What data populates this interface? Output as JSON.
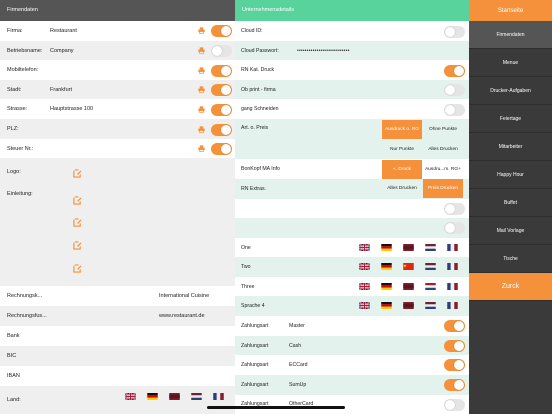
{
  "left": {
    "header": "Firmendaten",
    "fields": [
      {
        "label": "Firma:",
        "value": "Restaurant",
        "toggle": true
      },
      {
        "label": "Betriebsname:",
        "value": "Company",
        "toggle": false
      },
      {
        "label": "Mobiltelefon:",
        "value": "",
        "toggle": true
      },
      {
        "label": "Stadt:",
        "value": "Frankfurt",
        "toggle": true
      },
      {
        "label": "Strasse:",
        "value": "Hauptstrasse 100",
        "toggle": true
      },
      {
        "label": "PLZ:",
        "value": "",
        "toggle": true
      },
      {
        "label": "Steuer Nr.:",
        "value": "",
        "toggle": true
      }
    ],
    "logo_label": "Logo:",
    "einleitung_label": "Einleitung:",
    "rechnungsk_label": "Rechnungsk...",
    "rechnungsk_value": "International Cuisine",
    "rechnungsfus_label": "Rechnungsfus...",
    "rechnungsfus_value": "www.restaurant.de",
    "bank_label": "Bank",
    "bic_label": "BIC",
    "iban_label": "IBAN",
    "land_label": "Land:"
  },
  "mid": {
    "header": "Unternehmensdetails",
    "cloud_id": "Cloud ID:",
    "cloud_password": "Cloud Passwort:",
    "cloud_password_value": "•••••••••••••••••••••••••••",
    "rn_kat_druck": "RN Kat. Druck",
    "ob_print": "Ob print - firma",
    "gang": "gang Schneiden",
    "art_preis": "Art. o. Preis",
    "art_opt1": "Ausdruck o. RG",
    "art_opt2": "Ohne Punkte",
    "art_opt3": "Nur Punkte",
    "art_opt4": "Alles Drucken",
    "bonkopf": "BonKopf MA Info",
    "bon_opt1": "«. Druck",
    "bon_opt2": "Ausdru...m. RG+",
    "rn_extras": "RN Extras.",
    "rn_opt1": "Alles Drucken",
    "rn_opt2": "Preis Drucken",
    "lang_rows": [
      "One",
      "Two",
      "Three",
      "Sprache 4"
    ],
    "zahlungen": [
      {
        "label": "Zahlungsart",
        "value": "Master"
      },
      {
        "label": "Zahlungsart",
        "value": "Cash"
      },
      {
        "label": "Zahlungsart",
        "value": "ECCard"
      },
      {
        "label": "Zahlungsart",
        "value": "SumUp"
      },
      {
        "label": "Zahlungsart",
        "value": "OtherCard"
      }
    ]
  },
  "nav": {
    "title": "Startseite",
    "items": [
      "Firmendaten",
      "Menue",
      "Drucker-Aufgaben",
      "Feiertage",
      "Mitarbeiter",
      "Happy Hour",
      "Buffet",
      "Mail Vorlage",
      "Tische"
    ],
    "zurck": "Zurck"
  },
  "colors": {
    "accent": "#f5913a",
    "mint_header": "#57d39b",
    "dark_header": "#555555",
    "nav_bg": "#3a3a3a",
    "mint_row": "#e3f2ec",
    "grey_row": "#efefef"
  },
  "icons": {
    "printer": "printer-icon",
    "edit": "edit-image-icon",
    "flags": [
      "uk-flag-icon",
      "germany-flag-icon",
      "spain-flag-icon",
      "netherlands-flag-icon",
      "france-flag-icon"
    ]
  }
}
